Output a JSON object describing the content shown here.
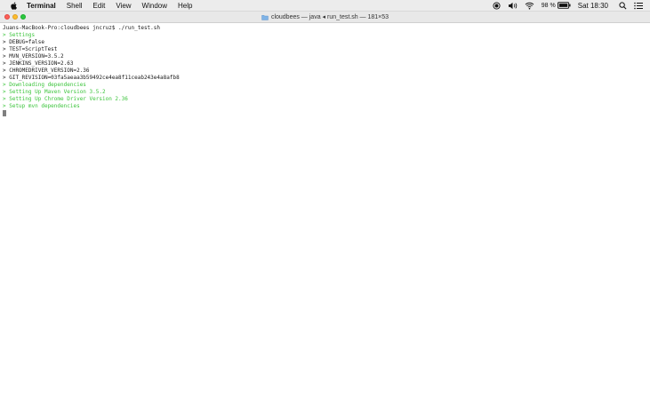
{
  "menubar": {
    "apple_icon": "apple-icon",
    "app_name": "Terminal",
    "items": [
      "Shell",
      "Edit",
      "View",
      "Window",
      "Help"
    ],
    "battery_percent": "98 %",
    "clock": "Sat 18:30",
    "status_icons": [
      "record-icon",
      "volume-icon",
      "wifi-icon",
      "battery-icon",
      "search-icon",
      "list-icon"
    ]
  },
  "window": {
    "title": "cloudbees — java ◂ run_test.sh — 181×53",
    "traffic_lights": [
      "close",
      "minimize",
      "zoom"
    ]
  },
  "terminal": {
    "prompt_line": "Juans-MacBook-Pro:cloudbees jncruz$ ./run_test.sh",
    "lines": [
      {
        "text": "> Settings",
        "color": "green"
      },
      {
        "text": "> DEBUG=false",
        "color": "default"
      },
      {
        "text": "> TEST=ScriptTest",
        "color": "default"
      },
      {
        "text": "> MVN_VERSION=3.5.2",
        "color": "default"
      },
      {
        "text": "> JENKINS_VERSION=2.63",
        "color": "default"
      },
      {
        "text": "> CHROMEDRIVER_VERSION=2.36",
        "color": "default"
      },
      {
        "text": "> GIT_REVISION=03fa5aeaa3b59492ce4ea8f11ceab243e4a8afb8",
        "color": "default"
      },
      {
        "text": "> Downloading dependencies",
        "color": "green"
      },
      {
        "text": "> Setting Up Maven Version 3.5.2",
        "color": "green"
      },
      {
        "text": "> Setting Up Chrome Driver Version 2.36",
        "color": "green"
      },
      {
        "text": "> Setup mvn dependencies",
        "color": "green"
      }
    ],
    "colors": {
      "green": "#3bc43b",
      "default": "#1a1a1a"
    }
  }
}
